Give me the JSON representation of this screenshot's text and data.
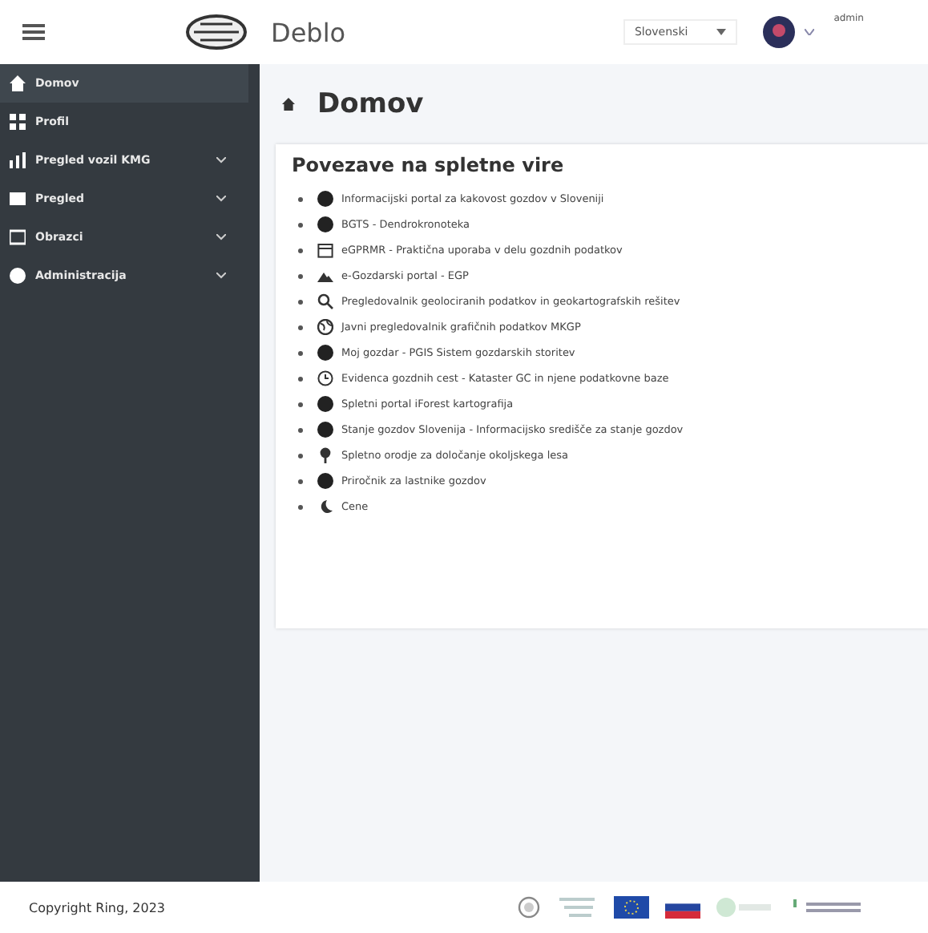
{
  "header": {
    "app_name": "Deblo",
    "language": "Slovenski",
    "user": "admin"
  },
  "sidebar": {
    "items": [
      {
        "label": "Domov",
        "selected": true,
        "expandable": false
      },
      {
        "label": "Profil",
        "selected": false,
        "expandable": false
      },
      {
        "label": "Pregled vozil KMG",
        "selected": false,
        "expandable": true
      },
      {
        "label": "Pregled",
        "selected": false,
        "expandable": true
      },
      {
        "label": "Obrazci",
        "selected": false,
        "expandable": true
      },
      {
        "label": "Administracija",
        "selected": false,
        "expandable": true
      }
    ]
  },
  "page": {
    "title": "Domov"
  },
  "links_card": {
    "title": "Povezave na spletne vire",
    "links": [
      {
        "text": "Informacijski portal za kakovost gozdov v Sloveniji",
        "kind": "disc"
      },
      {
        "text": "BGTS - Dendrokronoteka",
        "kind": "disc"
      },
      {
        "text": "eGPRMR - Praktična uporaba v delu gozdnih podatkov",
        "kind": "calendar"
      },
      {
        "text": "e-Gozdarski portal - EGP",
        "kind": "mountain"
      },
      {
        "text": "Pregledovalnik geolociranih podatkov in geokartografskih rešitev",
        "kind": "search"
      },
      {
        "text": "Javni pregledovalnik grafičnih podatkov MKGP",
        "kind": "globe"
      },
      {
        "text": "Moj gozdar - PGIS Sistem gozdarskih storitev",
        "kind": "disc"
      },
      {
        "text": "Evidenca gozdnih cest - Kataster GC in njene podatkovne baze",
        "kind": "clock"
      },
      {
        "text": "Spletni portal iForest kartografija",
        "kind": "disc"
      },
      {
        "text": "Stanje gozdov Slovenija - Informacijsko središče za stanje gozdov",
        "kind": "disc"
      },
      {
        "text": "Spletno orodje za določanje okoljskega lesa",
        "kind": "tree"
      },
      {
        "text": "Priročnik za lastnike gozdov",
        "kind": "disc"
      },
      {
        "text": "Cene",
        "kind": "moon"
      }
    ]
  },
  "footer": {
    "copyright": "Copyright Ring, 2023"
  }
}
